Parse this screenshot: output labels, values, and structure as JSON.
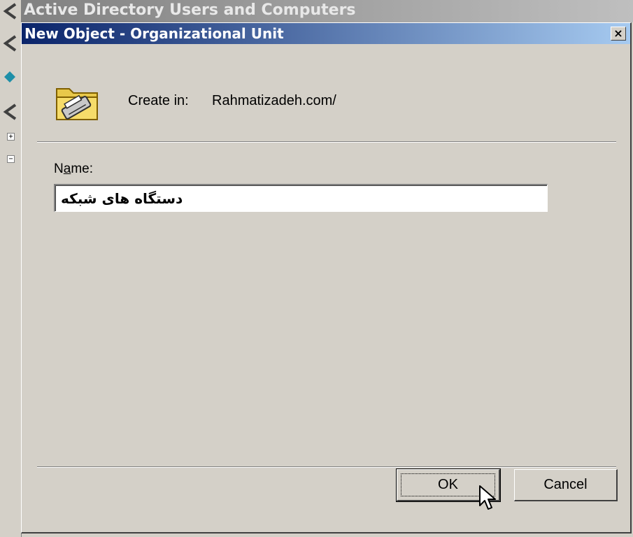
{
  "parent_window": {
    "title": "Active Directory Users and Computers"
  },
  "dialog": {
    "title": "New Object - Organizational Unit",
    "close_label": "×",
    "folder_icon": "folder-icon",
    "create_in_label": "Create in:",
    "create_in_value": "Rahmatizadeh.com/",
    "name_label_prefix": "N",
    "name_label_accel": "a",
    "name_label_suffix": "me:",
    "name_value": "دستگاه های شبکه",
    "ok_label": "OK",
    "cancel_label": "Cancel"
  },
  "colors": {
    "titlebar_start": "#0a246a",
    "titlebar_end": "#a6caf0",
    "face": "#d4d0c8"
  }
}
